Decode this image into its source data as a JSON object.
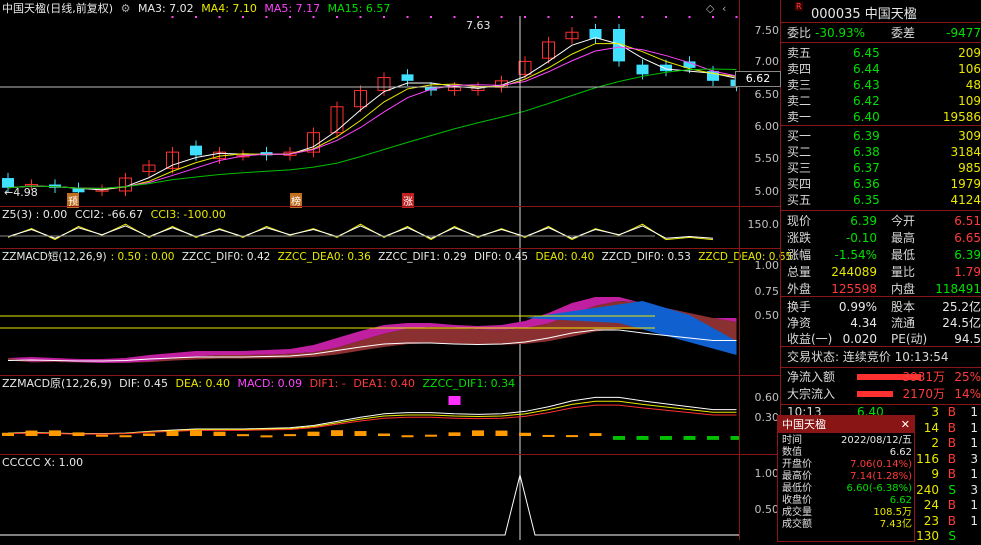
{
  "main_legend": {
    "title": "中国天楹(日线,前复权)",
    "ma3": "MA3: 7.02",
    "ma4": "MA4: 7.10",
    "ma5": "MA5: 7.17",
    "ma15": "MA15: 6.57"
  },
  "price_axis": [
    "7.50",
    "7.00",
    "6.50",
    "6.00",
    "5.50",
    "5.00"
  ],
  "cur_price_tag": "6.62",
  "high_label": "7.63",
  "low_label": "←4.98",
  "markers": [
    "预",
    "榜",
    "涨"
  ],
  "z5_legend": {
    "name": "Z5(3) : 0.00",
    "cci2": "CCI2: -66.67",
    "cci3": "CCI3: -100.00"
  },
  "z5_axis": "150.0",
  "macd_short_legend": {
    "name": "ZZMACD短(12,26,9)",
    "vals": ": 0.50 : 0.00",
    "dif0": "ZZCC_DIF0: 0.42",
    "dea0": "ZZCC_DEA0: 0.36",
    "dif1": "ZZCC_DIF1: 0.29",
    "dif0b": "DIF0: 0.45",
    "dea0b": "DEA0: 0.40",
    "zzcd_dif0": "ZZCD_DIF0: 0.53",
    "zzcd_dea0": "ZZCD_DEA0: 0.65"
  },
  "macd_short_axis": [
    "1.00",
    "0.75",
    "0.50"
  ],
  "macd_orig_legend": {
    "name": "ZZMACD原(12,26,9)",
    "dif": "DIF: 0.45",
    "dea": "DEA: 0.40",
    "macd": "MACD: 0.09",
    "dif1": "DIF1: -",
    "dea1": "DEA1: 0.40",
    "zzcc": "ZZCC_DIF1: 0.34"
  },
  "macd_orig_axis": [
    "0.60",
    "0.30"
  ],
  "ccccc_legend": "CCCCC X: 1.00",
  "ccccc_axis": [
    "1.00",
    "0.50"
  ],
  "right": {
    "code_name": "000035 中国天楹",
    "r_badge": "R",
    "weibi_label": "委比",
    "weibi": "-30.93%",
    "weicha_label": "委差",
    "weicha": "-9477",
    "asks": [
      {
        "label": "卖五",
        "price": "6.45",
        "vol": "209"
      },
      {
        "label": "卖四",
        "price": "6.44",
        "vol": "106"
      },
      {
        "label": "卖三",
        "price": "6.43",
        "vol": "48"
      },
      {
        "label": "卖二",
        "price": "6.42",
        "vol": "109"
      },
      {
        "label": "卖一",
        "price": "6.40",
        "vol": "19586"
      }
    ],
    "bids": [
      {
        "label": "买一",
        "price": "6.39",
        "vol": "309"
      },
      {
        "label": "买二",
        "price": "6.38",
        "vol": "3184"
      },
      {
        "label": "买三",
        "price": "6.37",
        "vol": "985"
      },
      {
        "label": "买四",
        "price": "6.36",
        "vol": "1979"
      },
      {
        "label": "买五",
        "price": "6.35",
        "vol": "4124"
      }
    ],
    "stats": [
      {
        "k1": "现价",
        "v1": "6.39",
        "c1": "grn",
        "k2": "今开",
        "v2": "6.51",
        "c2": "red"
      },
      {
        "k1": "涨跌",
        "v1": "-0.10",
        "c1": "grn",
        "k2": "最高",
        "v2": "6.65",
        "c2": "red"
      },
      {
        "k1": "涨幅",
        "v1": "-1.54%",
        "c1": "grn",
        "k2": "最低",
        "v2": "6.39",
        "c2": "grn"
      },
      {
        "k1": "总量",
        "v1": "244089",
        "c1": "yel",
        "k2": "量比",
        "v2": "1.79",
        "c2": "red"
      },
      {
        "k1": "外盘",
        "v1": "125598",
        "c1": "red",
        "k2": "内盘",
        "v2": "118491",
        "c2": "grn"
      }
    ],
    "stats2": [
      {
        "k1": "换手",
        "v1": "0.99%",
        "k2": "股本",
        "v2": "25.2亿"
      },
      {
        "k1": "净资",
        "v1": "4.34",
        "k2": "流通",
        "v2": "24.5亿"
      },
      {
        "k1": "收益(一)",
        "v1": "0.020",
        "k2": "PE(动)",
        "v2": "94.5"
      }
    ],
    "trade_status": "交易状态: 连续竞价 10:13:54",
    "flow": [
      {
        "label": "净流入额",
        "val": "3931万",
        "pct": "25%"
      },
      {
        "label": "大宗流入",
        "val": "2170万",
        "pct": "14%"
      }
    ],
    "ticks": [
      {
        "t": "10:13",
        "p": "6.40",
        "v": "3",
        "s": "B"
      },
      {
        "t": "",
        "p": "",
        "v": "14",
        "s": "B"
      },
      {
        "t": "",
        "p": "",
        "v": "2",
        "s": "B"
      },
      {
        "t": "",
        "p": "",
        "v": "116",
        "s": "B"
      },
      {
        "t": "",
        "p": "",
        "v": "9",
        "s": "B"
      },
      {
        "t": "",
        "p": "",
        "v": "240",
        "s": "S"
      },
      {
        "t": "",
        "p": "",
        "v": "24",
        "s": "B"
      },
      {
        "t": "",
        "p": "",
        "v": "23",
        "s": "B"
      },
      {
        "t": "",
        "p": "",
        "v": "130",
        "s": "S"
      }
    ],
    "tick_extra": [
      "1",
      "1",
      "1",
      "3",
      "1",
      "3",
      "1",
      "1"
    ]
  },
  "popup": {
    "title": "中国天楹",
    "close": "✕",
    "rows": [
      {
        "k": "时间",
        "v": "2022/08/12/五",
        "c": "wht"
      },
      {
        "k": "数值",
        "v": "6.62",
        "c": "wht"
      },
      {
        "k": "开盘价",
        "v": "7.06(0.14%)",
        "c": "red"
      },
      {
        "k": "最高价",
        "v": "7.14(1.28%)",
        "c": "red"
      },
      {
        "k": "最低价",
        "v": "6.60(-6.38%)",
        "c": "grn"
      },
      {
        "k": "收盘价",
        "v": "6.62",
        "c": "grn"
      },
      {
        "k": "成交量",
        "v": "108.5万",
        "c": "yel"
      },
      {
        "k": "成交额",
        "v": "7.43亿",
        "c": "yel"
      }
    ]
  }
}
